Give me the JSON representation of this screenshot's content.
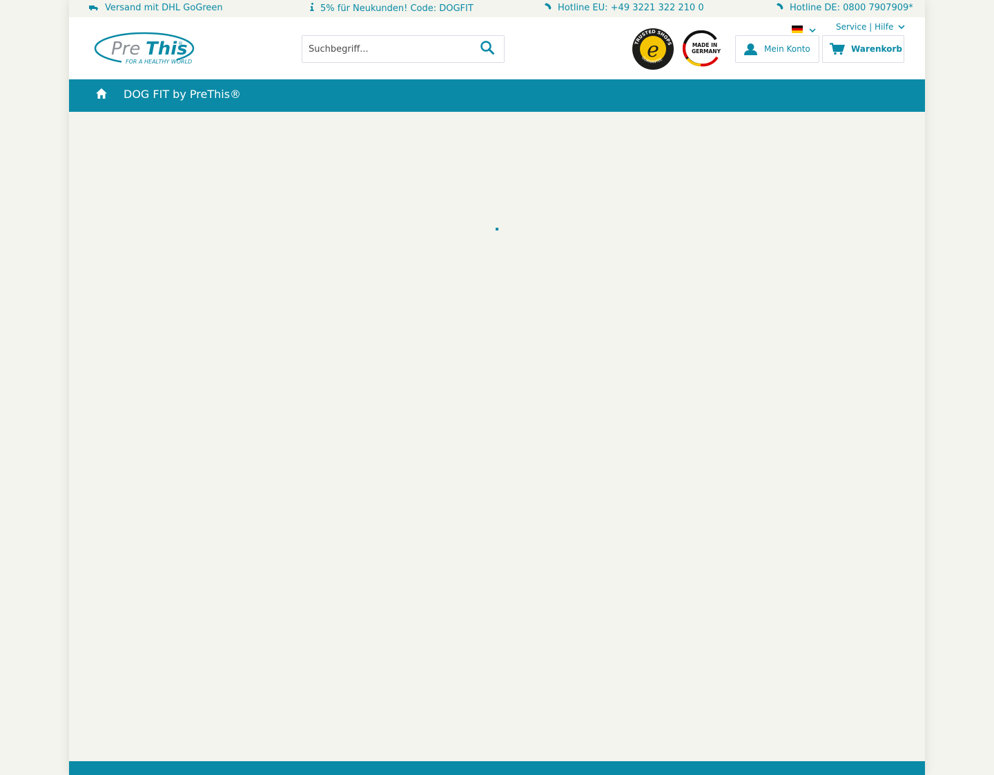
{
  "topbar": {
    "shipping": "Versand mit DHL GoGreen",
    "promo": "5% für Neukunden! Code: DOGFIT",
    "hotline_eu": "Hotline EU: +49 3221 322 210 0",
    "hotline_de": "Hotline DE: 0800 7907909*"
  },
  "header": {
    "logo_text": "PreThis",
    "logo_tagline": "FOR A HEALTHY WORLD",
    "search_placeholder": "Suchbegriff...",
    "trust_badge_text": "TRUSTED SHOPS GUARANTEE",
    "made_in_badge_text": "MADE IN GERMANY",
    "language": "de",
    "service_label": "Service | Hilfe",
    "account_label": "Mein Konto",
    "cart_label": "Warenkorb"
  },
  "nav": {
    "items": [
      "DOG FIT by PreThis®"
    ]
  },
  "colors": {
    "brand": "#0a8aa6",
    "background": "#f3f4ed",
    "header_bg": "#ffffff",
    "nav_text": "#ffffff"
  },
  "icons": [
    "truck-icon",
    "info-icon",
    "phone-icon",
    "search-icon",
    "flag-de-icon",
    "chevron-down-icon",
    "user-icon",
    "cart-icon",
    "home-icon"
  ]
}
